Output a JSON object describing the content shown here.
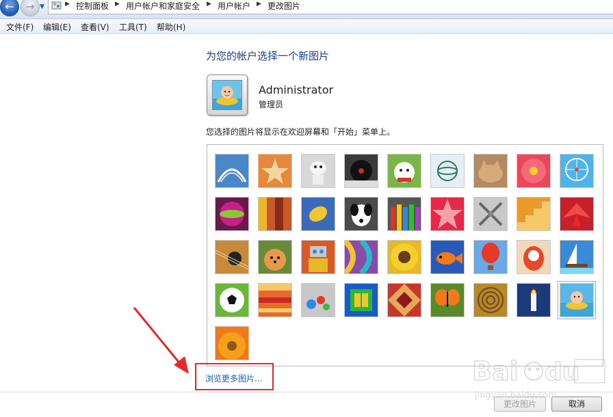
{
  "breadcrumb": [
    {
      "label": "控制面板"
    },
    {
      "label": "用户帐户和家庭安全"
    },
    {
      "label": "用户帐户"
    },
    {
      "label": "更改图片"
    }
  ],
  "menu": [
    {
      "label": "文件(F)"
    },
    {
      "label": "编辑(E)"
    },
    {
      "label": "查看(V)"
    },
    {
      "label": "工具(T)"
    },
    {
      "label": "帮助(H)"
    }
  ],
  "page_title": "为您的帐户选择一个新图片",
  "user": {
    "name": "Administrator",
    "role": "管理员"
  },
  "hint": "您选择的图片将显示在欢迎屏幕和「开始」菜单上。",
  "pictures": [
    {
      "name": "roller-coaster",
      "bg": "#4a86c8"
    },
    {
      "name": "starfish",
      "bg": "#e8883a"
    },
    {
      "name": "robot-toy",
      "bg": "#d8d8d8"
    },
    {
      "name": "record-player",
      "bg": "#3a3a3a"
    },
    {
      "name": "lucky-cat",
      "bg": "#7ab648"
    },
    {
      "name": "gyroscope",
      "bg": "#e6eef5"
    },
    {
      "name": "kitten",
      "bg": "#b58a62"
    },
    {
      "name": "flower",
      "bg": "#e8485a"
    },
    {
      "name": "ferris-wheel",
      "bg": "#4fb4e8"
    },
    {
      "name": "ball",
      "bg": "#6a1a4a"
    },
    {
      "name": "fabric",
      "bg": "#c85a28"
    },
    {
      "name": "leaf",
      "bg": "#3a6ab8"
    },
    {
      "name": "dog",
      "bg": "#4a4a4a"
    },
    {
      "name": "crayons",
      "bg": "#555555"
    },
    {
      "name": "star-lantern",
      "bg": "#e8284a"
    },
    {
      "name": "jacks",
      "bg": "#c8c8c8"
    },
    {
      "name": "stairs",
      "bg": "#e89a2a"
    },
    {
      "name": "paper-crane",
      "bg": "#c8202a"
    },
    {
      "name": "guitar",
      "bg": "#c88a3a"
    },
    {
      "name": "pomeranian",
      "bg": "#6a8a3a"
    },
    {
      "name": "tin-robot",
      "bg": "#d85a2a"
    },
    {
      "name": "scarves",
      "bg": "#8a4aa8"
    },
    {
      "name": "sunflower",
      "bg": "#e8b82a"
    },
    {
      "name": "fish",
      "bg": "#2a5ab8"
    },
    {
      "name": "hot-air-balloon",
      "bg": "#6aa8e8"
    },
    {
      "name": "daruma",
      "bg": "#f0d8b8"
    },
    {
      "name": "sailboat",
      "bg": "#3a8ad8"
    },
    {
      "name": "soccer-ball",
      "bg": "#6ab83a"
    },
    {
      "name": "orange-fabric",
      "bg": "#e86a2a"
    },
    {
      "name": "marbles",
      "bg": "#c8c8c8"
    },
    {
      "name": "window",
      "bg": "#1a5ac8"
    },
    {
      "name": "textile",
      "bg": "#c8382a"
    },
    {
      "name": "butterfly",
      "bg": "#5a8a2a"
    },
    {
      "name": "spiral",
      "bg": "#b8882a"
    },
    {
      "name": "lighthouse",
      "bg": "#1a3a7a"
    },
    {
      "name": "baby-swimming",
      "bg": "#5ab8e8",
      "selected": true
    },
    {
      "name": "gerbera",
      "bg": "#f07a1a"
    }
  ],
  "browse_link": "浏览更多图片...",
  "buttons": {
    "change_picture": "更改图片",
    "cancel": "取消"
  },
  "colors": {
    "link": "#1a5fb4",
    "title": "#1e3d8f",
    "annotation_red": "#e8282a"
  },
  "watermark": {
    "brand": "Baidu",
    "cn": "经验",
    "url": "jingyan.baidu.com"
  }
}
